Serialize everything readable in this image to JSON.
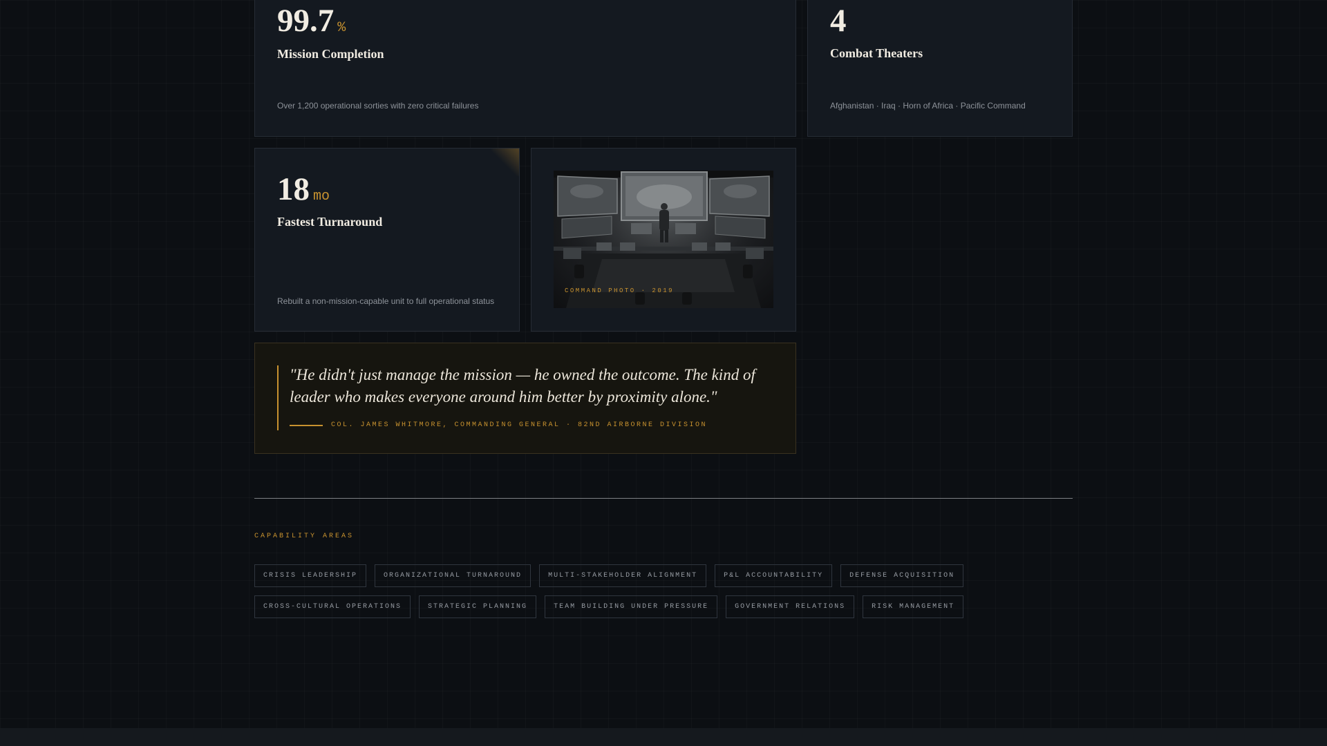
{
  "stats": {
    "mission": {
      "value": "99.7",
      "unit": "%",
      "title": "Mission Completion",
      "desc": "Over 1,200 operational sorties with zero critical failures"
    },
    "theaters": {
      "value": "4",
      "unit": "",
      "title": "Combat Theaters",
      "desc": "Afghanistan · Iraq · Horn of Africa · Pacific Command"
    },
    "turnaround": {
      "value": "18",
      "unit": "mo",
      "title": "Fastest Turnaround",
      "desc": "Rebuilt a non-mission-capable unit to full operational status"
    }
  },
  "photo": {
    "caption": "COMMAND PHOTO · 2019"
  },
  "testimonial": {
    "quote": "\"He didn't just manage the mission — he owned the outcome. The kind of leader who makes everyone around him better by proximity alone.\"",
    "cite": "COL. JAMES WHITMORE, COMMANDING GENERAL · 82ND AIRBORNE DIVISION"
  },
  "capabilities": {
    "label": "CAPABILITY AREAS",
    "row1": [
      "CRISIS LEADERSHIP",
      "ORGANIZATIONAL TURNAROUND",
      "MULTI-STAKEHOLDER ALIGNMENT",
      "P&L ACCOUNTABILITY",
      "DEFENSE ACQUISITION"
    ],
    "row2": [
      "CROSS-CULTURAL OPERATIONS",
      "STRATEGIC PLANNING",
      "TEAM BUILDING UNDER PRESSURE",
      "GOVERNMENT RELATIONS",
      "RISK MANAGEMENT"
    ]
  },
  "colors": {
    "accent": "#c8922f",
    "background": "#0c0f13",
    "card": "#141920"
  }
}
